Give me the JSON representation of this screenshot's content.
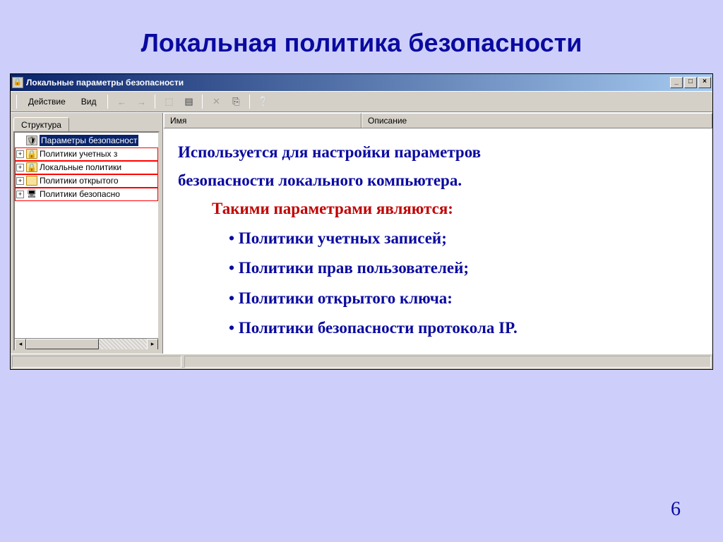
{
  "slide": {
    "title": "Локальная политика безопасности",
    "page_number": "6"
  },
  "window": {
    "title": "Локальные параметры безопасности",
    "controls": {
      "minimize": "_",
      "maximize": "□",
      "close": "×"
    }
  },
  "toolbar": {
    "menu_action": "Действие",
    "menu_view": "Вид"
  },
  "left": {
    "tab": "Структура",
    "nodes": [
      {
        "label": "Параметры безопасност",
        "icon": "shield",
        "expand": "none",
        "selected": true
      },
      {
        "label": "Политики учетных з",
        "icon": "locked",
        "expand": "+",
        "hl": true
      },
      {
        "label": "Локальные политики",
        "icon": "locked",
        "expand": "+",
        "hl": true
      },
      {
        "label": "Политики открытого",
        "icon": "folder",
        "expand": "+",
        "hl": true
      },
      {
        "label": "Политики безопасно",
        "icon": "ip",
        "expand": "+",
        "hl": true
      }
    ]
  },
  "columns": {
    "name": "Имя",
    "desc": "Описание"
  },
  "overlay": {
    "line1": "Используется для настройки параметров",
    "line2": "безопасности локального компьютера.",
    "subhead": "Такими параметрами являются:",
    "bullets": [
      "Политики учетных записей;",
      "Политики прав пользователей;",
      "Политики открытого ключа:",
      "Политики безопасности протокола IP."
    ]
  }
}
